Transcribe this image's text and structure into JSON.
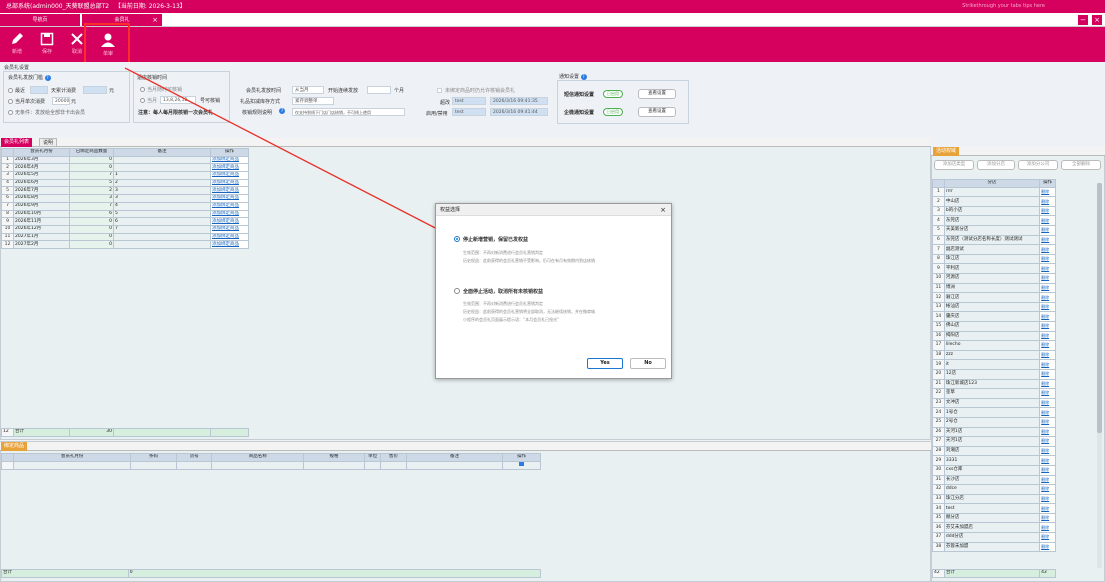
{
  "title_bar": {
    "title": "总部系统(admin000_天葵联盟总部T2",
    "date": "【当前日期: 2026-3-13】",
    "right_hint": "Strikethrough your tabs tips here"
  },
  "tabs": [
    {
      "label": "导航页"
    },
    {
      "label": "会员礼"
    }
  ],
  "window": {
    "minimize": "−",
    "close": "×"
  },
  "toolbar": {
    "items": [
      {
        "label": "新增",
        "icon": "pencil-icon"
      },
      {
        "label": "保存",
        "icon": "save-icon"
      },
      {
        "label": "取消",
        "icon": "cancel-icon"
      },
      {
        "label": "单审",
        "icon": "user-icon"
      }
    ]
  },
  "settings": {
    "section_title": "会员礼设置",
    "threshold_title": "会员礼发放门槛",
    "threshold_opts": [
      {
        "label": "最近",
        "value": "",
        "suffix": "天累计消费",
        "unit": "元"
      },
      {
        "label": "当月单次消费",
        "value": "20000",
        "unit": "元"
      },
      {
        "label": "无条件：发放给全部非卡出会员"
      }
    ],
    "storeexp_title": "适店核销时间",
    "storeexp_opts": [
      {
        "label": "当月随时可核销"
      },
      {
        "label": "当月",
        "value": "13,8,26,12",
        "suffix": "号可核销"
      }
    ],
    "note": "注意：每人每月限核销一次会员礼",
    "give_time_label": "会员礼发放时间",
    "give_time_value": "从当月",
    "consec_label": "开始连续发放",
    "consec_unit": "个月",
    "deduct_label": "礼品扣减库存方式",
    "deduct_value": "紧存调整单",
    "rule_label": "核销规则说明",
    "rule_value": "仅支持到线下门店门店核销，不可线上使用",
    "unlinked_label": "未绑定商品时仍允许核销会员礼",
    "audit": [
      {
        "label": "超改",
        "user": "test",
        "time": "2026/3/16 09:41:35"
      },
      {
        "label": "启用/禁用",
        "user": "test",
        "time": "2026/3/16 09:41:44"
      }
    ],
    "notify_title": "通知设置",
    "notify": [
      {
        "label": "短信通知设置",
        "toggle": "已启用",
        "button": "查看设置"
      },
      {
        "label": "企微通知设置",
        "toggle": "已启用",
        "button": "查看设置"
      }
    ]
  },
  "gift_list": {
    "tabs": [
      {
        "label": "会员礼列表"
      },
      {
        "label": "说明"
      }
    ],
    "headers": [
      "会员礼月份",
      "已绑定商品数量",
      "备注",
      "操作"
    ],
    "rows": [
      {
        "no": "1",
        "month": "2026年3月",
        "qty": "0",
        "note": "",
        "op": "添加绑定商品"
      },
      {
        "no": "2",
        "month": "2026年4月",
        "qty": "0",
        "note": "",
        "op": "添加绑定商品"
      },
      {
        "no": "3",
        "month": "2026年5月",
        "qty": "7",
        "note": "1",
        "op": "添加绑定商品"
      },
      {
        "no": "4",
        "month": "2026年6月",
        "qty": "5",
        "note": "2",
        "op": "添加绑定商品"
      },
      {
        "no": "5",
        "month": "2026年7月",
        "qty": "2",
        "note": "3",
        "op": "添加绑定商品"
      },
      {
        "no": "6",
        "month": "2026年8月",
        "qty": "3",
        "note": "3",
        "op": "添加绑定商品"
      },
      {
        "no": "7",
        "month": "2026年9月",
        "qty": "7",
        "note": "4",
        "op": "添加绑定商品"
      },
      {
        "no": "8",
        "month": "2026年10月",
        "qty": "6",
        "note": "5",
        "op": "添加绑定商品"
      },
      {
        "no": "9",
        "month": "2026年11月",
        "qty": "0",
        "note": "6",
        "op": "添加绑定商品"
      },
      {
        "no": "10",
        "month": "2026年12月",
        "qty": "0",
        "note": "7",
        "op": "添加绑定商品"
      },
      {
        "no": "11",
        "month": "2027年1月",
        "qty": "0",
        "note": "",
        "op": "添加绑定商品"
      },
      {
        "no": "12",
        "month": "2027年2月",
        "qty": "0",
        "note": "",
        "op": "添加绑定商品"
      }
    ],
    "total_no": "12",
    "total_label": "合计",
    "total_qty": "30"
  },
  "bound_goods": {
    "tab": "绑定商品",
    "headers": [
      "会员礼月份",
      "条码",
      "货号",
      "商品名称",
      "规格",
      "单位",
      "售价",
      "备注",
      "操作"
    ],
    "total_label": "合计",
    "total_value": "0"
  },
  "activity": {
    "tab": "活动权域",
    "buttons": [
      "添加店类型",
      "添加分店",
      "添加分公司",
      "全部删除"
    ],
    "headers": [
      "分店",
      "操作"
    ],
    "op": "删除",
    "rows": [
      {
        "no": "1",
        "name": "rrrr"
      },
      {
        "no": "2",
        "name": "中山店"
      },
      {
        "no": "3",
        "name": "b的小店"
      },
      {
        "no": "4",
        "name": "东莞店"
      },
      {
        "no": "5",
        "name": "天美新分店"
      },
      {
        "no": "6",
        "name": "东莞店（测试分店名称长度）测试测试"
      },
      {
        "no": "7",
        "name": "副店测试"
      },
      {
        "no": "8",
        "name": "珠江店"
      },
      {
        "no": "9",
        "name": "平利店"
      },
      {
        "no": "10",
        "name": "河源店"
      },
      {
        "no": "11",
        "name": "博洲"
      },
      {
        "no": "12",
        "name": "骊江店"
      },
      {
        "no": "13",
        "name": "帐汕店"
      },
      {
        "no": "14",
        "name": "肇庆店"
      },
      {
        "no": "15",
        "name": "佛山店"
      },
      {
        "no": "16",
        "name": "揭阳店"
      },
      {
        "no": "17",
        "name": "lilecho"
      },
      {
        "no": "18",
        "name": "zzz"
      },
      {
        "no": "19",
        "name": "it"
      },
      {
        "no": "20",
        "name": "12店"
      },
      {
        "no": "21",
        "name": "珠江新城店123"
      },
      {
        "no": "22",
        "name": "茎草"
      },
      {
        "no": "23",
        "name": "文冲店"
      },
      {
        "no": "24",
        "name": "1号仓"
      },
      {
        "no": "25",
        "name": "2号仓"
      },
      {
        "no": "26",
        "name": "天河1店"
      },
      {
        "no": "27",
        "name": "天河1店"
      },
      {
        "no": "28",
        "name": "刘潮店"
      },
      {
        "no": "29",
        "name": "3331"
      },
      {
        "no": "30",
        "name": "cxs仓库"
      },
      {
        "no": "31",
        "name": "长沙店"
      },
      {
        "no": "32",
        "name": "ddce"
      },
      {
        "no": "33",
        "name": "珠江分店"
      },
      {
        "no": "34",
        "name": "test"
      },
      {
        "no": "35",
        "name": "赫分店"
      },
      {
        "no": "36",
        "name": "芬艾未加盟店"
      },
      {
        "no": "37",
        "name": "ddd分店"
      },
      {
        "no": "38",
        "name": "芬蓉未加盟"
      }
    ],
    "total_no": "42",
    "total_label": "合计",
    "total_value": "43"
  },
  "dialog": {
    "title": "权益选择",
    "close": "×",
    "opt1_label": "停止新增营销，保留已发权益",
    "opt1_l1": "生效范围：不再对新消费进行会员礼营销判定",
    "opt1_l2": "历史权益：此前获得的会员礼营销不受影响，仍可在有月有效期内到店核销",
    "opt2_label": "全面停止活动，取消所有未核销权益",
    "opt2_l1": "生效范围：不再对新消费进行会员礼营销判定",
    "opt2_l2": "历史权益：此前获得的会员礼营销将全部取消，无法继续核销，并在微商城",
    "opt2_l3": "小程序的会员礼页面展示提示语：“本月会员礼已抢光”",
    "yes": "Yes",
    "no": "No"
  },
  "colors": {
    "brand": "#d6005e",
    "arrow": "#e8302a"
  }
}
